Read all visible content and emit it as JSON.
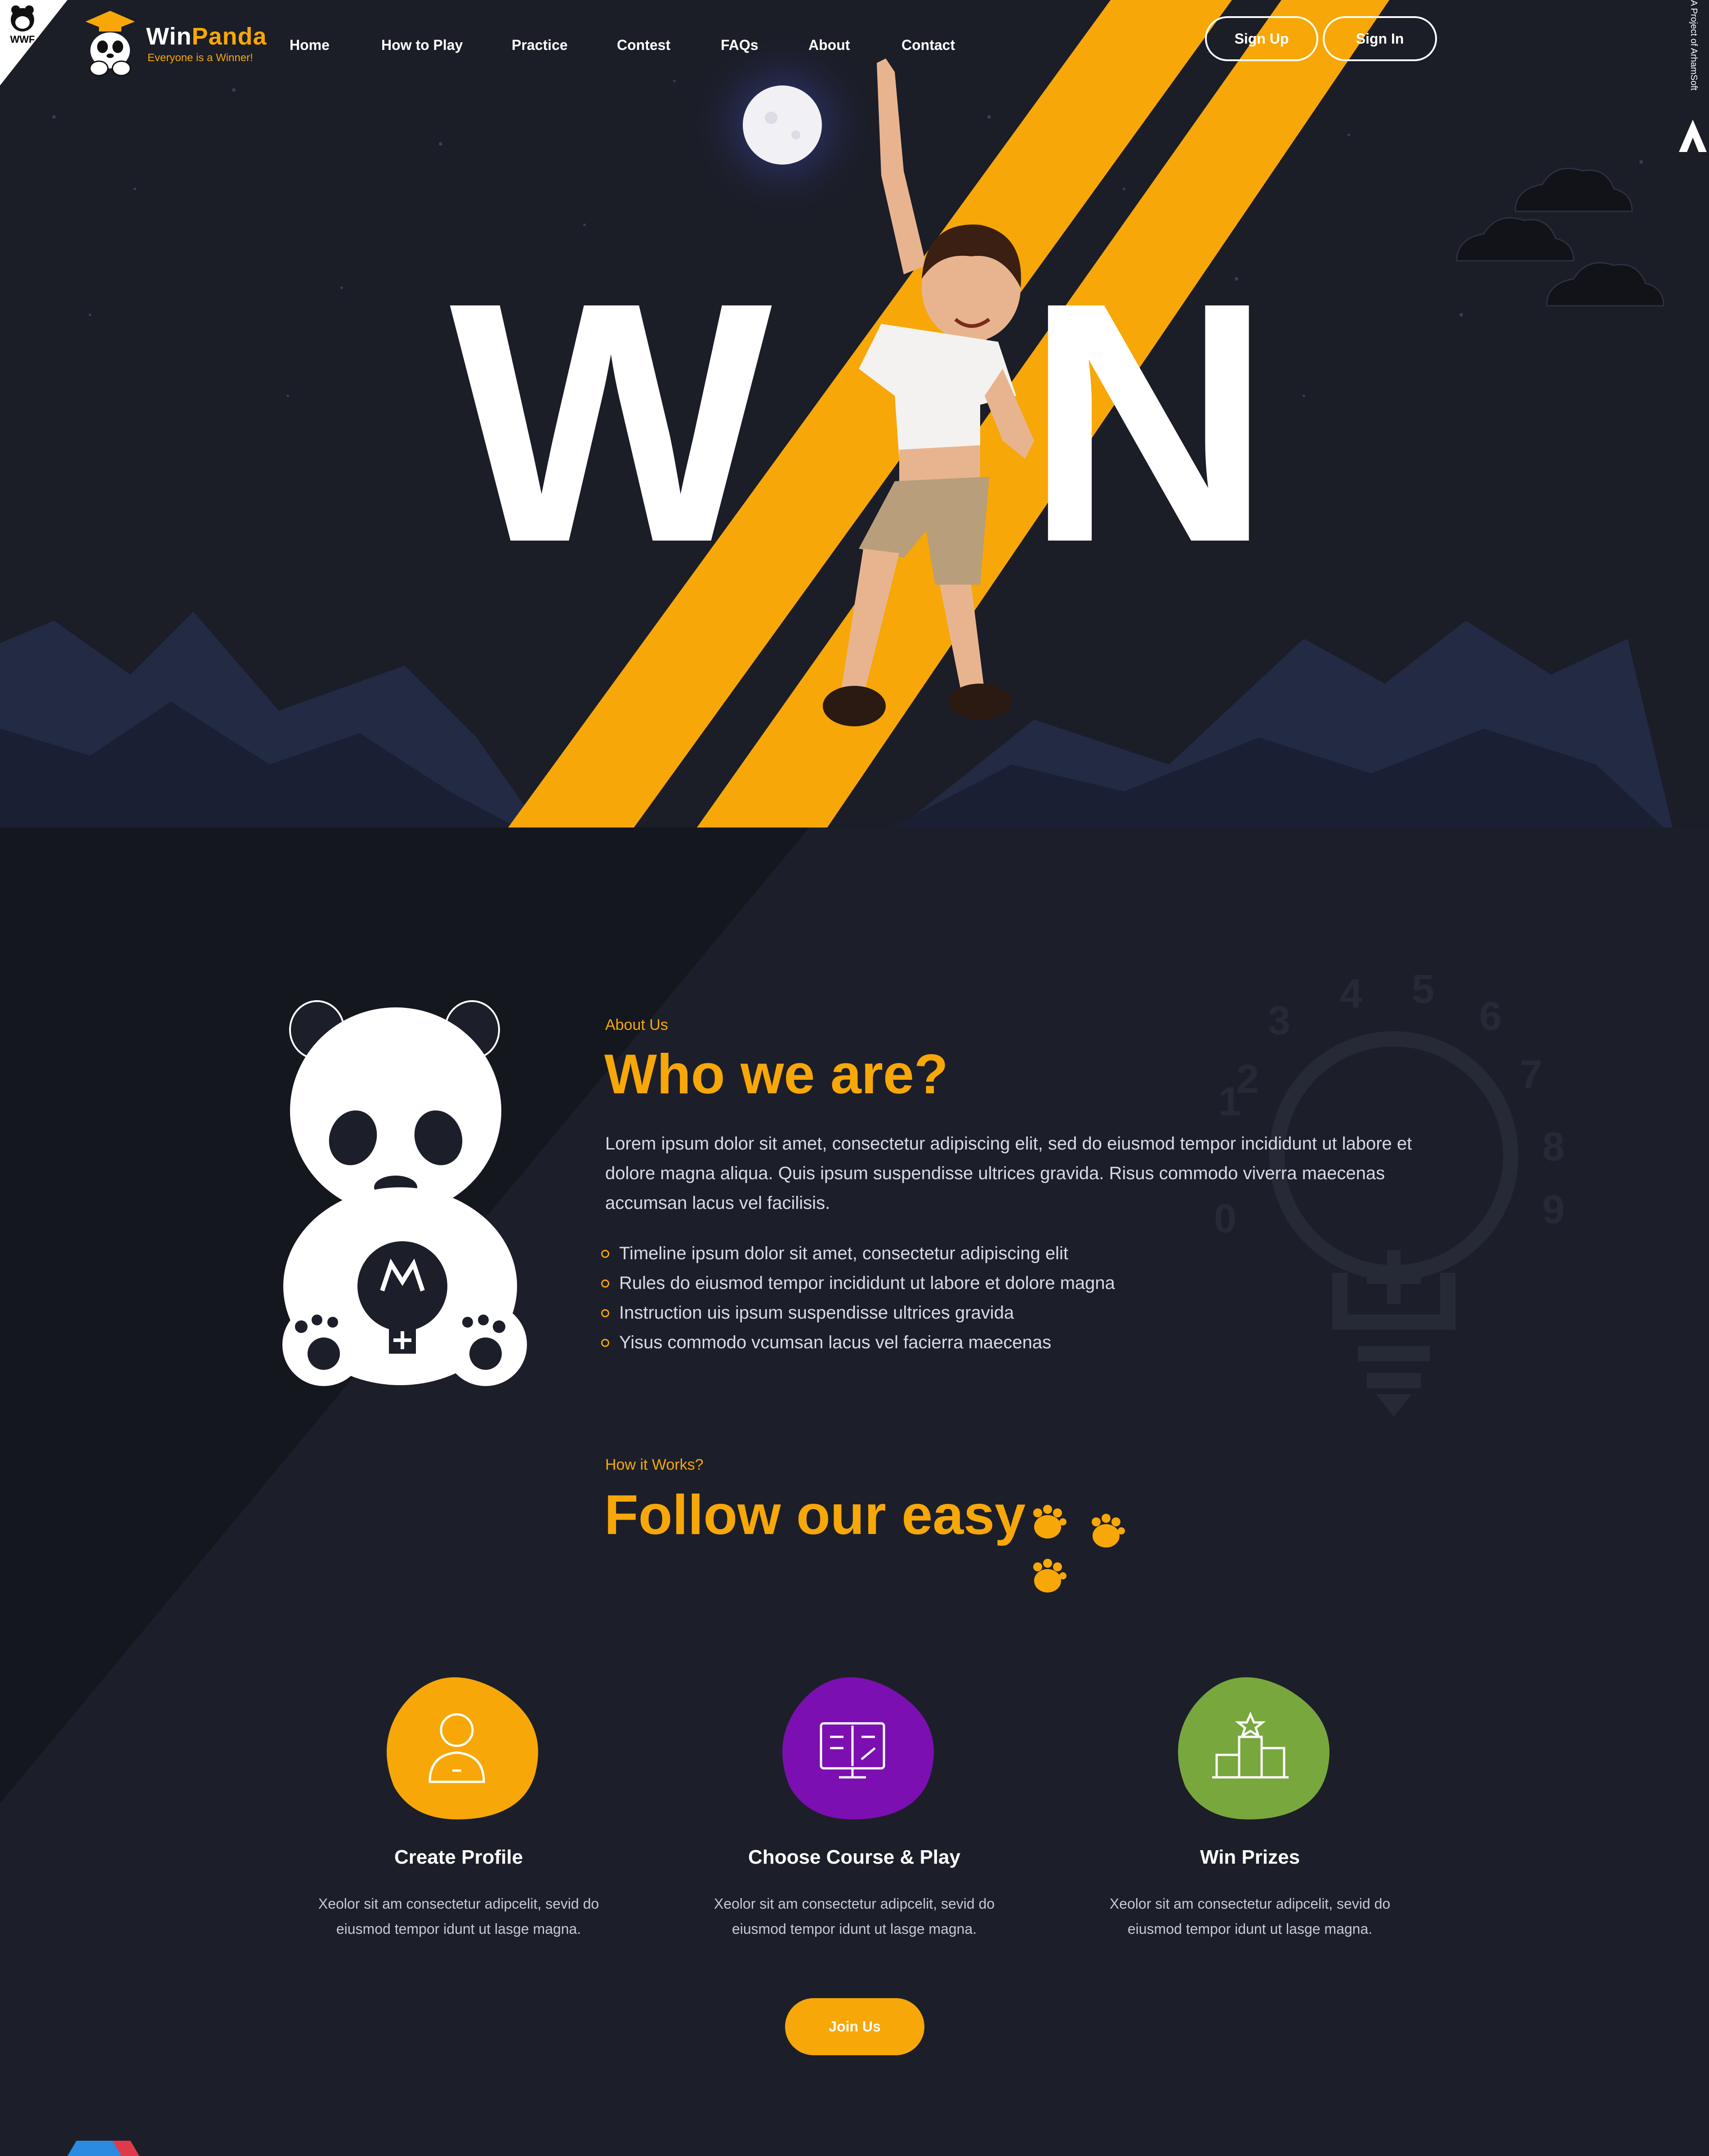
{
  "brand": {
    "wwf_badge": "WWF",
    "name_part1": "Win",
    "name_part2": "Panda",
    "tagline": "Everyone is a Winner!"
  },
  "nav": {
    "items": [
      {
        "label": "Home"
      },
      {
        "label": "How to Play"
      },
      {
        "label": "Practice"
      },
      {
        "label": "Contest"
      },
      {
        "label": "FAQs"
      },
      {
        "label": "About"
      },
      {
        "label": "Contact"
      }
    ],
    "signup_label": "Sign Up",
    "signin_label": "Sign In"
  },
  "side_credit": "A Project of ArhamSoft",
  "hero": {
    "letter_left": "W",
    "letter_right": "N"
  },
  "about": {
    "eyebrow": "About Us",
    "title": "Who we are?",
    "paragraph": "Lorem ipsum dolor sit amet, consectetur adipiscing elit, sed do eiusmod tempor incididunt ut labore et dolore magna aliqua. Quis ipsum suspendisse ultrices gravida. Risus commodo viverra maecenas accumsan lacus vel facilisis.",
    "bullets": [
      "Timeline ipsum dolor sit amet, consectetur adipiscing elit",
      "Rules do eiusmod tempor incididunt ut labore et dolore magna",
      "Instruction uis ipsum suspendisse ultrices gravida",
      "Yisus commodo vcumsan lacus vel facierra maecenas"
    ],
    "bulb_digits": [
      "1",
      "2",
      "3",
      "4",
      "5",
      "6",
      "7",
      "8",
      "9",
      "0"
    ]
  },
  "how": {
    "eyebrow": "How it Works?",
    "title": "Follow our easy",
    "steps": [
      {
        "title": "Create Profile",
        "desc": "Xeolor sit am consectetur adipcelit, sevid do eiusmod tempor idunt ut lasge magna.",
        "color": "#f7a707",
        "icon": "user-icon"
      },
      {
        "title": "Choose Course & Play",
        "desc": "Xeolor sit am consectetur adipcelit, sevid do eiusmod tempor idunt ut lasge magna.",
        "color": "#7b0fb2",
        "icon": "book-icon"
      },
      {
        "title": "Win Prizes",
        "desc": "Xeolor sit am consectetur adipcelit, sevid do eiusmod tempor idunt ut lasge magna.",
        "color": "#78a73d",
        "icon": "podium-icon"
      }
    ],
    "join_label": "Join Us"
  },
  "colors": {
    "accent": "#f7a707",
    "background": "#1c1f29",
    "hero_background": "#1b1d27"
  }
}
